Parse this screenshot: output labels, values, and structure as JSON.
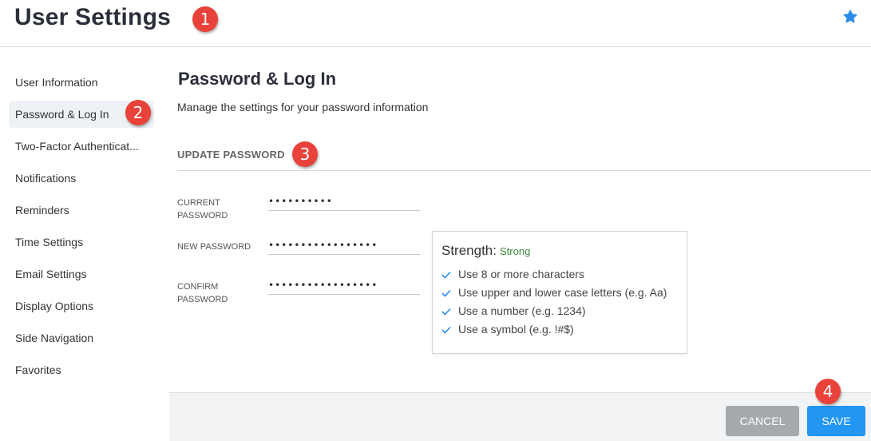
{
  "header": {
    "title": "User Settings"
  },
  "sidebar": {
    "items": [
      {
        "label": "User Information"
      },
      {
        "label": "Password & Log In"
      },
      {
        "label": "Two-Factor Authenticat..."
      },
      {
        "label": "Notifications"
      },
      {
        "label": "Reminders"
      },
      {
        "label": "Time Settings"
      },
      {
        "label": "Email Settings"
      },
      {
        "label": "Display Options"
      },
      {
        "label": "Side Navigation"
      },
      {
        "label": "Favorites"
      }
    ],
    "active_item": "Password & Log In"
  },
  "main": {
    "title": "Password & Log In",
    "description": "Manage the settings for your password information",
    "subheading": "UPDATE PASSWORD",
    "fields": {
      "current": {
        "label": "CURRENT PASSWORD",
        "value": "••••••••••"
      },
      "new": {
        "label": "NEW PASSWORD",
        "value": "•••••••••••••••••"
      },
      "confirm": {
        "label": "CONFIRM PASSWORD",
        "value": "•••••••••••••••••"
      }
    },
    "strength": {
      "label": "Strength:",
      "value": "Strong",
      "rules": [
        "Use 8 or more characters",
        "Use upper and lower case letters (e.g. Aa)",
        "Use a number (e.g. 1234)",
        "Use a symbol (e.g. !#$)"
      ]
    }
  },
  "footer": {
    "cancel_label": "CANCEL",
    "save_label": "SAVE"
  },
  "badges": [
    "1",
    "2",
    "3",
    "4"
  ],
  "colors": {
    "accent": "#2196f3",
    "badge": "#e8423a",
    "strength_good": "#3a8a3a",
    "check": "#2b8be8",
    "cancel": "#a6a9ad"
  },
  "icons": {
    "favorite": "star-icon",
    "rule_met": "checkmark-icon"
  }
}
